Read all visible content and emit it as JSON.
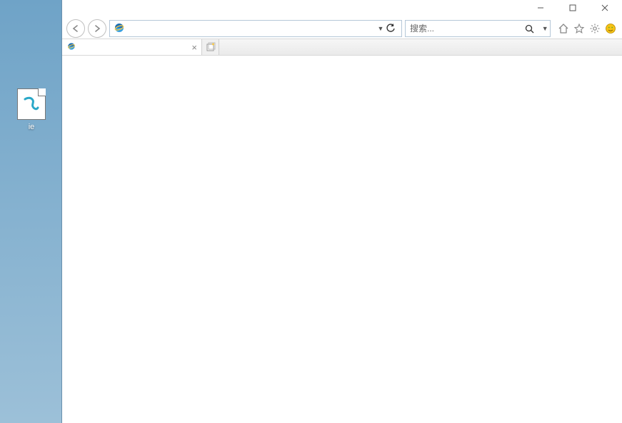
{
  "desktop": {
    "icon_label": "ie"
  },
  "window_controls": {
    "minimize": "minimize",
    "maximize": "maximize",
    "close": "close"
  },
  "toolbar": {
    "back": "back",
    "forward": "forward",
    "address_value": "",
    "refresh": "refresh",
    "search_placeholder": "搜索...",
    "search_value": "",
    "icons": {
      "home": "home",
      "favorites": "favorites",
      "tools": "tools",
      "emoji": "emoji"
    }
  },
  "tabs": [
    {
      "title": "",
      "icon": "ie-logo"
    }
  ]
}
